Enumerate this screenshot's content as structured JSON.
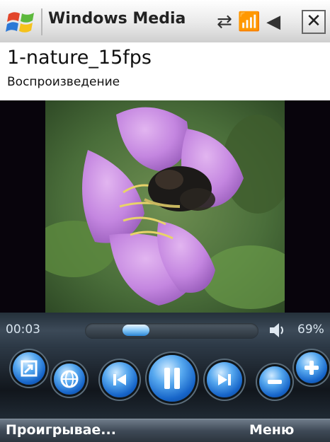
{
  "titlebar": {
    "app_title": "Windows Media",
    "close_label": "✕"
  },
  "track": {
    "title": "1-nature_15fps",
    "status": "Воспроизведение"
  },
  "playback": {
    "elapsed": "00:03",
    "progress_fraction": 0.25,
    "volume": "69%"
  },
  "controls": {
    "buttons": [
      "fullscreen-button",
      "web-button",
      "previous-button",
      "pause-button",
      "next-button",
      "volume-down-button",
      "volume-up-button"
    ]
  },
  "softkeys": {
    "left": "Проигрывае...",
    "right": "Меню"
  },
  "colors": {
    "accent": "#2b85d4",
    "orb_blue": "#1664c8"
  }
}
